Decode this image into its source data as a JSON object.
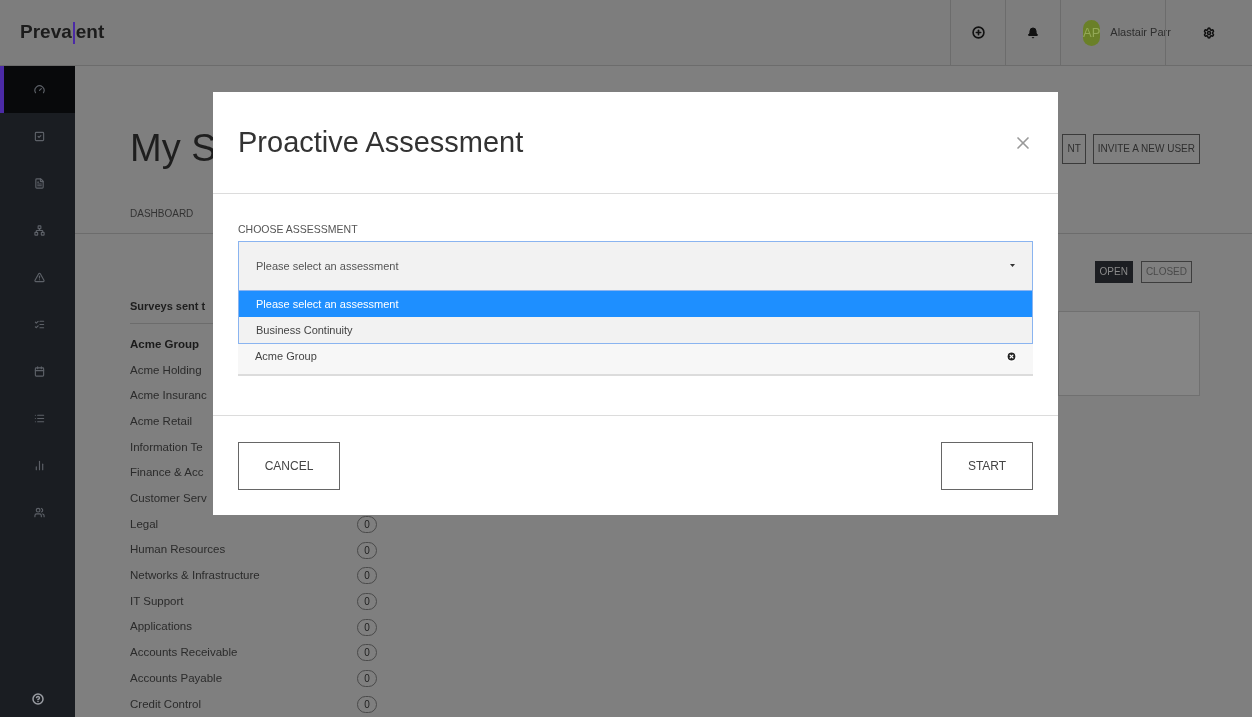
{
  "header": {
    "logo": {
      "before": "Preva",
      "after": "ent"
    },
    "user": {
      "initials": "AP",
      "name": "Alastair Parr"
    }
  },
  "sidebar": {
    "items": [
      {
        "selected": true
      },
      {
        "selected": false
      },
      {
        "selected": false
      },
      {
        "selected": false
      },
      {
        "selected": false
      },
      {
        "selected": false
      },
      {
        "selected": false
      },
      {
        "selected": false
      },
      {
        "selected": false
      },
      {
        "selected": false
      }
    ]
  },
  "page": {
    "title": "My S",
    "actions": [
      "NT",
      "INVITE A NEW USER"
    ],
    "tabs": [
      "DASHBOARD"
    ],
    "filters": [
      {
        "label": "OPEN",
        "selected": true
      },
      {
        "label": "CLOSED",
        "selected": false
      }
    ],
    "surveys": {
      "heading": "Surveys sent t",
      "items": [
        {
          "name": "Acme Group",
          "selected": true
        },
        {
          "name": "Acme Holding",
          "selected": false
        },
        {
          "name": "Acme Insuranc",
          "selected": false
        },
        {
          "name": "Acme Retail",
          "selected": false
        },
        {
          "name": "Information Te",
          "selected": false
        },
        {
          "name": "Finance & Acc",
          "selected": false
        },
        {
          "name": "Customer Serv",
          "selected": false
        },
        {
          "name": "Legal",
          "selected": false,
          "count": "0"
        },
        {
          "name": "Human Resources",
          "selected": false,
          "count": "0"
        },
        {
          "name": "Networks & Infrastructure",
          "selected": false,
          "count": "0"
        },
        {
          "name": "IT Support",
          "selected": false,
          "count": "0"
        },
        {
          "name": "Applications",
          "selected": false,
          "count": "0"
        },
        {
          "name": "Accounts Receivable",
          "selected": false,
          "count": "0"
        },
        {
          "name": "Accounts Payable",
          "selected": false,
          "count": "0"
        },
        {
          "name": "Credit Control",
          "selected": false,
          "count": "0"
        }
      ]
    }
  },
  "modal": {
    "title": "Proactive Assessment",
    "field": {
      "label": "CHOOSE ASSESSMENT",
      "value": "Please select an assessment",
      "expanded": true,
      "options": [
        {
          "label": "Please select an assessment",
          "selected": true
        },
        {
          "label": "Business Continuity",
          "selected": false
        }
      ]
    },
    "tags": [
      "Acme Group"
    ],
    "cancel": "CANCEL",
    "start": "START"
  }
}
